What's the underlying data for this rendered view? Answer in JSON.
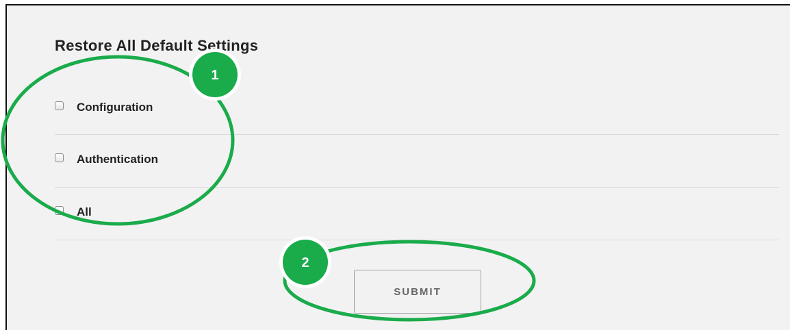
{
  "page": {
    "title": "Restore All Default Settings"
  },
  "options": [
    {
      "label": "Configuration",
      "checked": false
    },
    {
      "label": "Authentication",
      "checked": false
    },
    {
      "label": "All",
      "checked": false
    }
  ],
  "submit": {
    "label": "SUBMIT"
  },
  "callouts": {
    "first": "1",
    "second": "2",
    "color": "#1aab4b"
  }
}
